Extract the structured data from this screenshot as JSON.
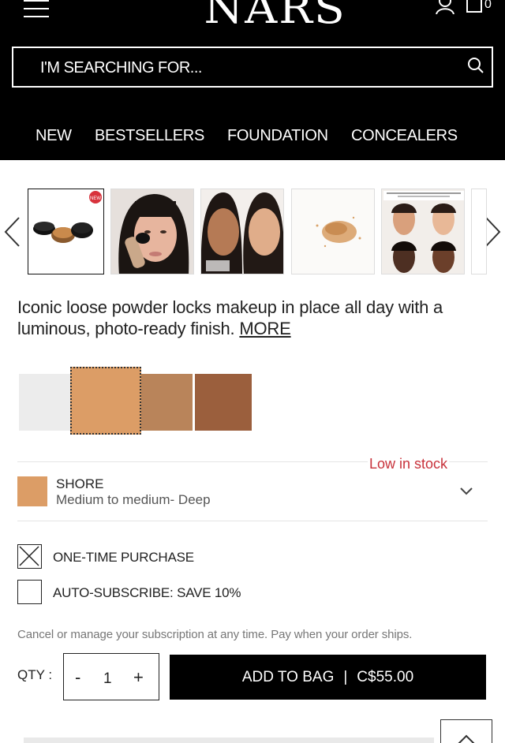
{
  "header": {
    "logo": "NARS",
    "bag_count": "0",
    "search_placeholder": "I'M SEARCHING FOR...",
    "nav": [
      "NEW",
      "BESTSELLERS",
      "FOUNDATION",
      "CONCEALERS"
    ]
  },
  "gallery": {
    "thumb1_badge": "NEW"
  },
  "product": {
    "description": "Iconic loose powder locks makeup in place all day with a luminous, photo-ready finish.",
    "more_link": "MORE",
    "stock_status": "Low in stock",
    "shade_name": "SHORE",
    "shade_desc": "Medium to medium- Deep"
  },
  "swatches": {
    "colors": [
      "#ececec",
      "#dc9d66",
      "#b9845a",
      "#9b5f3d"
    ],
    "selected_index": 1
  },
  "purchase": {
    "one_time_label": "ONE-TIME PURCHASE",
    "subscribe_label": "AUTO-SUBSCRIBE: SAVE 10%",
    "note": "Cancel or manage your subscription at any time. Pay when your order ships.",
    "qty_label": "QTY :",
    "qty_minus": "-",
    "qty_value": "1",
    "qty_plus": "+",
    "add_to_bag": "ADD TO BAG",
    "separator": "|",
    "price": "C$55.00"
  },
  "colors": {
    "accent_red": "#c8323b",
    "header_bg": "#000000"
  }
}
